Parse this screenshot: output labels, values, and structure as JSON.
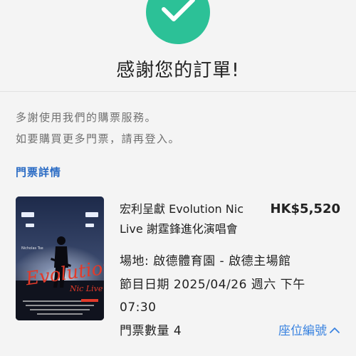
{
  "header": {
    "icon": "check-icon",
    "accent_color": "#2cc197",
    "title": "感謝您的訂單!"
  },
  "message": {
    "line1": "多謝使用我們的購票服務。",
    "line2": "如要購買更多門票，請再登入。"
  },
  "ticket_details": {
    "heading": "門票詳情",
    "poster": {
      "icon": "event-poster-image",
      "artist_label": "Nicholas Tse",
      "art_title": "Evolution",
      "art_subtitle": "Nic Live"
    },
    "event_name": "宏利呈獻 Evolution Nic Live 謝霆鋒進化演唱會",
    "price": "HK$5,520",
    "venue": "場地: 啟德體育園 - 啟德主場館",
    "date": "節目日期 2025/04/26 週六 下午 07:30",
    "quantity": "門票數量 4",
    "seat_link": "座位編號",
    "seat_link_icon": "chevron-up-icon"
  }
}
